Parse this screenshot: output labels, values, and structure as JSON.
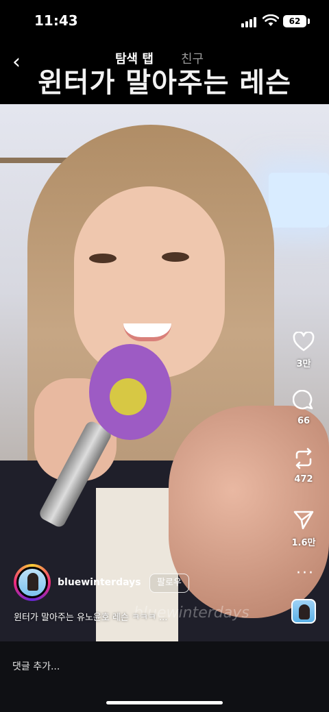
{
  "status": {
    "time": "11:43",
    "battery": "62",
    "icons": [
      "signal-icon",
      "wifi-icon",
      "battery-icon"
    ]
  },
  "header": {
    "back_icon": "chevron-left-icon",
    "tab_explore": "탐색 탭",
    "tab_friends": "친구"
  },
  "video": {
    "caption": "윈터가 말아주는 레슨",
    "watermark": "bluewinterdays"
  },
  "actions": {
    "like_count": "3만",
    "comment_count": "66",
    "repost_count": "472",
    "share_count": "1.6만",
    "more_icon": "more-horizontal-icon"
  },
  "post": {
    "username": "bluewinterdays",
    "follow_label": "팔로우",
    "description": "윈터가 말아주는 유노윤호 레슨 ㅋㅋㅋ ..."
  },
  "bottom": {
    "comment_placeholder": "댓글 추가..."
  },
  "colors": {
    "background": "#000000",
    "bottom_bar": "#0f1014",
    "story_ring": [
      "#f9ce34",
      "#ee2a7b",
      "#6228d7"
    ]
  }
}
